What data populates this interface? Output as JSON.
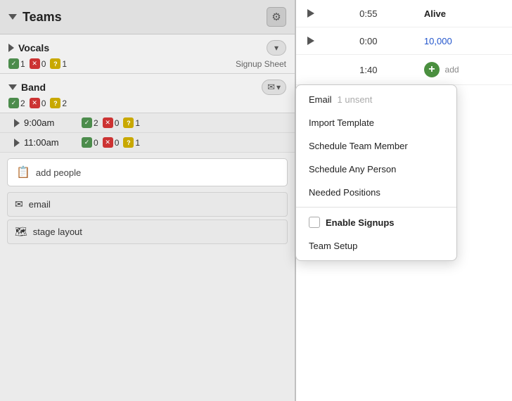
{
  "panel": {
    "title": "Teams",
    "gear_label": "⚙"
  },
  "vocals": {
    "label": "Vocals",
    "stats": [
      {
        "type": "check",
        "value": "1"
      },
      {
        "type": "x",
        "value": "0"
      },
      {
        "type": "q",
        "value": "1"
      }
    ],
    "signup_label": "Signup Sheet",
    "expand_label": "▾"
  },
  "band": {
    "label": "Band",
    "stats": [
      {
        "type": "check",
        "value": "2"
      },
      {
        "type": "x",
        "value": "0"
      },
      {
        "type": "q",
        "value": "2"
      }
    ],
    "email_label": "✉",
    "expand_label": "▾"
  },
  "time_slots": [
    {
      "time": "9:00am",
      "stats": [
        {
          "type": "check",
          "value": "2"
        },
        {
          "type": "x",
          "value": "0"
        },
        {
          "type": "q",
          "value": "1"
        }
      ]
    },
    {
      "time": "11:00am",
      "stats": [
        {
          "type": "check",
          "value": "0"
        },
        {
          "type": "x",
          "value": "0"
        },
        {
          "type": "q",
          "value": "1"
        }
      ]
    }
  ],
  "add_people": {
    "label": "add people",
    "icon": "🗓"
  },
  "bottom_buttons": [
    {
      "icon": "✉",
      "label": "email"
    },
    {
      "icon": "🗺",
      "label": "stage layout"
    }
  ],
  "right_panel": {
    "rows": [
      {
        "time": "0:55",
        "label": "Alive"
      },
      {
        "time": "0:00",
        "value": "10,000",
        "is_link": true
      },
      {
        "time": "1:40",
        "add": true
      }
    ]
  },
  "dropdown": {
    "items": [
      {
        "id": "email",
        "label": "Email",
        "count": "1 unsent",
        "divider_after": false
      },
      {
        "id": "import",
        "label": "Import Template",
        "divider_after": false
      },
      {
        "id": "schedule-member",
        "label": "Schedule Team Member",
        "divider_after": false
      },
      {
        "id": "schedule-person",
        "label": "Schedule Any Person",
        "divider_after": false
      },
      {
        "id": "positions",
        "label": "Needed Positions",
        "divider_after": true
      },
      {
        "id": "enable-signups",
        "label": "Enable Signups",
        "bold": true,
        "checkbox": true,
        "divider_after": false
      },
      {
        "id": "team-setup",
        "label": "Team Setup",
        "divider_after": false
      }
    ]
  }
}
